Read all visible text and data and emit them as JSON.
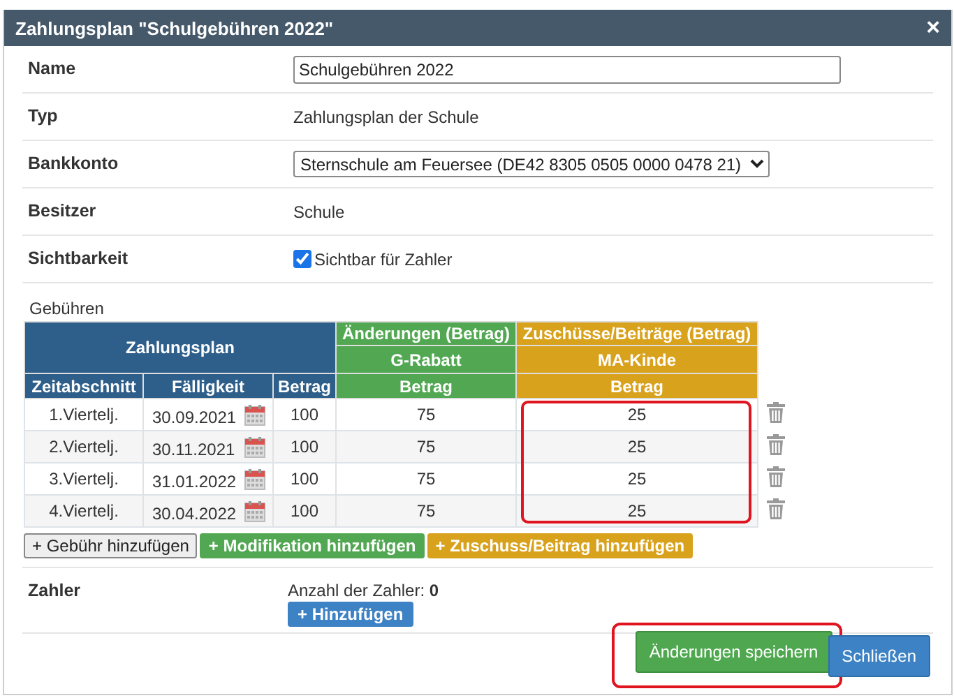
{
  "dialog": {
    "title": "Zahlungsplan \"Schulgebühren 2022\"",
    "close": "×"
  },
  "fields": [
    {
      "kind": "input",
      "label": "Name",
      "value": "Schulgebühren 2022"
    },
    {
      "kind": "text",
      "label": "Typ",
      "value": "Zahlungsplan der Schule"
    },
    {
      "kind": "select",
      "label": "Bankkonto",
      "value": "Sternschule am Feuersee (DE42 8305 0505 0000 0478 21)"
    },
    {
      "kind": "text",
      "label": "Besitzer",
      "value": "Schule"
    },
    {
      "kind": "checkbox",
      "label": "Sichtbarkeit",
      "value": "Sichtbar für Zahler",
      "checked": true
    }
  ],
  "fees": {
    "label": "Gebühren",
    "plan_header": "Zahlungsplan",
    "columns": [
      "Zeitabschnitt",
      "Fälligkeit",
      "Betrag"
    ],
    "groups": [
      {
        "kind": "modification",
        "title": "Änderungen (Betrag)",
        "item": "G-Rabatt",
        "amount_header": "Betrag",
        "highlighted": false
      },
      {
        "kind": "subsidy",
        "title": "Zuschüsse/Beiträge (Betrag)",
        "item": "MA-Kinde",
        "amount_header": "Betrag",
        "highlighted": true
      }
    ],
    "rows": [
      {
        "period": "1.Viertelj.",
        "due": "30.09.2021",
        "amount": "100",
        "values": [
          "75",
          "25"
        ]
      },
      {
        "period": "2.Viertelj.",
        "due": "30.11.2021",
        "amount": "100",
        "values": [
          "75",
          "25"
        ]
      },
      {
        "period": "3.Viertelj.",
        "due": "31.01.2022",
        "amount": "100",
        "values": [
          "75",
          "25"
        ]
      },
      {
        "period": "4.Viertelj.",
        "due": "30.04.2022",
        "amount": "100",
        "values": [
          "75",
          "25"
        ]
      }
    ],
    "buttons": [
      {
        "kind": "default",
        "label": "+ Gebühr hinzufügen"
      },
      {
        "kind": "modification",
        "label": "+ Modifikation hinzufügen"
      },
      {
        "kind": "subsidy",
        "label": "+ Zuschuss/Beitrag hinzufügen"
      }
    ]
  },
  "payers": {
    "label": "Zahler",
    "count_label": "Anzahl der Zahler:",
    "count": "0",
    "add": "+ Hinzufügen"
  },
  "footer": {
    "save": {
      "label": "Änderungen speichern",
      "highlighted": true
    },
    "close": {
      "label": "Schließen"
    }
  }
}
